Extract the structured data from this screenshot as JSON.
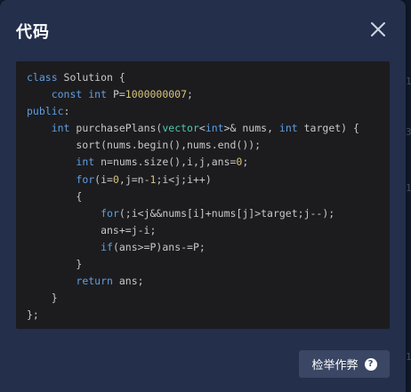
{
  "dialog": {
    "title": "代码",
    "close_icon": "close-icon",
    "report_button_label": "检举作弊",
    "help_icon": "help-icon",
    "help_glyph": "?"
  },
  "code": {
    "language": "cpp",
    "lines": [
      [
        {
          "t": "class",
          "c": "kw"
        },
        {
          "t": " Solution {",
          "c": ""
        }
      ],
      [
        {
          "t": "    ",
          "c": ""
        },
        {
          "t": "const int",
          "c": "kw"
        },
        {
          "t": " P=",
          "c": ""
        },
        {
          "t": "1000000007",
          "c": "nu"
        },
        {
          "t": ";",
          "c": ""
        }
      ],
      [
        {
          "t": "public",
          "c": "kw"
        },
        {
          "t": ":",
          "c": ""
        }
      ],
      [
        {
          "t": "    ",
          "c": ""
        },
        {
          "t": "int",
          "c": "kw"
        },
        {
          "t": " purchasePlans(",
          "c": ""
        },
        {
          "t": "vector",
          "c": "ty"
        },
        {
          "t": "<",
          "c": ""
        },
        {
          "t": "int",
          "c": "kw"
        },
        {
          "t": ">& nums, ",
          "c": ""
        },
        {
          "t": "int",
          "c": "kw"
        },
        {
          "t": " target) {",
          "c": ""
        }
      ],
      [
        {
          "t": "        sort(nums.begin(),nums.end());",
          "c": ""
        }
      ],
      [
        {
          "t": "        ",
          "c": ""
        },
        {
          "t": "int",
          "c": "kw"
        },
        {
          "t": " n=nums.size(),i,j,ans=",
          "c": ""
        },
        {
          "t": "0",
          "c": "nu"
        },
        {
          "t": ";",
          "c": ""
        }
      ],
      [
        {
          "t": "        ",
          "c": ""
        },
        {
          "t": "for",
          "c": "kw"
        },
        {
          "t": "(i=",
          "c": ""
        },
        {
          "t": "0",
          "c": "nu"
        },
        {
          "t": ",j=n-",
          "c": ""
        },
        {
          "t": "1",
          "c": "nu"
        },
        {
          "t": ";i<j;i++)",
          "c": ""
        }
      ],
      [
        {
          "t": "        {",
          "c": ""
        }
      ],
      [
        {
          "t": "            ",
          "c": ""
        },
        {
          "t": "for",
          "c": "kw"
        },
        {
          "t": "(;i<j&&nums[i]+nums[j]>target;j--);",
          "c": ""
        }
      ],
      [
        {
          "t": "            ans+=j-i;",
          "c": ""
        }
      ],
      [
        {
          "t": "            ",
          "c": ""
        },
        {
          "t": "if",
          "c": "kw"
        },
        {
          "t": "(ans>=P)ans-=P;",
          "c": ""
        }
      ],
      [
        {
          "t": "        }",
          "c": ""
        }
      ],
      [
        {
          "t": "        ",
          "c": ""
        },
        {
          "t": "return",
          "c": "kw"
        },
        {
          "t": " ans;",
          "c": ""
        }
      ],
      [
        {
          "t": "    }",
          "c": ""
        }
      ],
      [
        {
          "t": "};",
          "c": ""
        }
      ]
    ]
  },
  "colors": {
    "modal_bg": "#232f4b",
    "code_bg": "#1c1c1f",
    "keyword": "#5f9fe0",
    "type": "#4ec9b0",
    "number": "#d7c47a",
    "button_bg": "#3a4663"
  }
}
